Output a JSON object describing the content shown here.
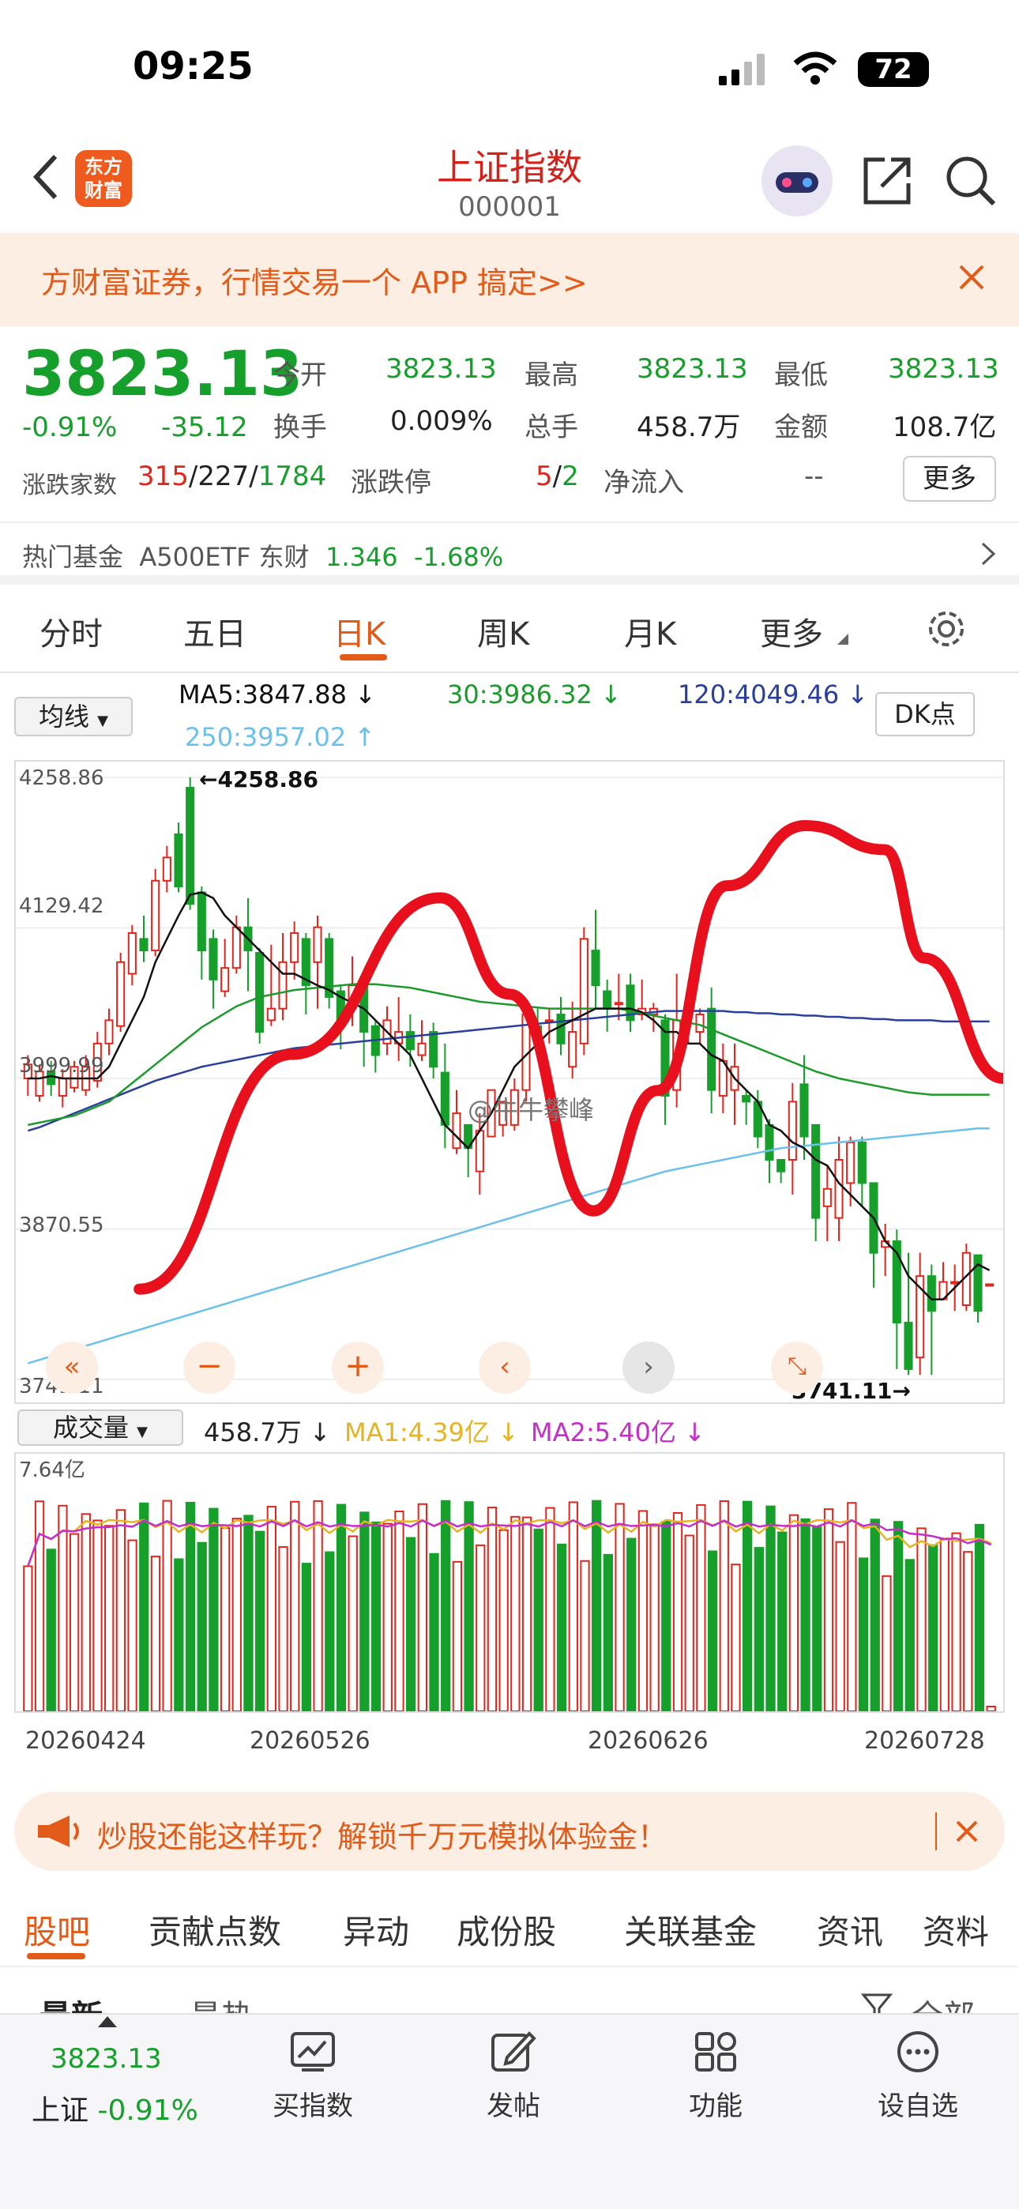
{
  "status_bar": {
    "time": "09:25",
    "battery": "72"
  },
  "header": {
    "title": "上证指数",
    "code": "000001",
    "logo_text": "东方财富"
  },
  "promo_banner": {
    "text": "方财富证券，行情交易一个 APP 搞定>>"
  },
  "quote": {
    "price": "3823.13",
    "change_pct": "-0.91%",
    "change": "-35.12",
    "open_label": "今开",
    "open": "3823.13",
    "high_label": "最高",
    "high": "3823.13",
    "low_label": "最低",
    "low": "3823.13",
    "turnover_label": "换手",
    "turnover": "0.009%",
    "volume_label": "总手",
    "volume": "458.7万",
    "amount_label": "金额",
    "amount": "108.7亿",
    "breadth_label": "涨跌家数",
    "up": "315",
    "flat": "227",
    "down": "1784",
    "sep": "/",
    "limit_label": "涨跌停",
    "limit_up": "5",
    "limit_down": "2",
    "netflow_label": "净流入",
    "netflow": "--",
    "more_label": "更多"
  },
  "hot_fund": {
    "label": "热门基金",
    "name": "A500ETF 东财",
    "price": "1.346",
    "change": "-1.68%"
  },
  "period_tabs": [
    "分时",
    "五日",
    "日K",
    "周K",
    "月K",
    "更多"
  ],
  "active_period": "日K",
  "ma": {
    "selector": "均线",
    "ma5": "MA5:3847.88 ↓",
    "ma30": "30:3986.32 ↓",
    "ma120": "120:4049.46 ↓",
    "ma250": "250:3957.02 ↑",
    "dk": "DK点"
  },
  "colors": {
    "up": "#e0251c",
    "down": "#16a02b",
    "ma5": "#111111",
    "ma30": "#1d9a2b",
    "ma120": "#2a3f9c",
    "ma250": "#6cc1ea",
    "accent": "#e25b18",
    "overlay": "#e8101c"
  },
  "chart_data": {
    "type": "candlestick",
    "ylim": [
      3741.11,
      4258.86
    ],
    "y_ticks": [
      "4258.86",
      "4129.42",
      "3999.99",
      "3870.55",
      "3741.11"
    ],
    "high_marker": "←4258.86",
    "low_marker": "3741.11→",
    "watermark": "@牛牛攀峰",
    "x_ticks": [
      "20260424",
      "20260526",
      "20260626",
      "20260728"
    ],
    "candles": [
      [
        4000,
        4012,
        4020,
        3985
      ],
      [
        3985,
        4006,
        4012,
        3980
      ],
      [
        4006,
        3995,
        4015,
        3985
      ],
      [
        3985,
        4000,
        4008,
        3975
      ],
      [
        3992,
        4010,
        4015,
        3988
      ],
      [
        3990,
        4010,
        4020,
        3985
      ],
      [
        3998,
        4030,
        4040,
        3992
      ],
      [
        4030,
        4050,
        4060,
        4020
      ],
      [
        4045,
        4100,
        4108,
        4040
      ],
      [
        4090,
        4125,
        4132,
        4080
      ],
      [
        4120,
        4110,
        4140,
        4100
      ],
      [
        4110,
        4170,
        4180,
        4105
      ],
      [
        4170,
        4190,
        4200,
        4160
      ],
      [
        4210,
        4165,
        4220,
        4160
      ],
      [
        4250,
        4150,
        4259,
        4145
      ],
      [
        4160,
        4110,
        4165,
        4085
      ],
      [
        4120,
        4085,
        4128,
        4060
      ],
      [
        4075,
        4095,
        4120,
        4070
      ],
      [
        4095,
        4130,
        4140,
        4090
      ],
      [
        4130,
        4110,
        4155,
        4075
      ],
      [
        4108,
        4040,
        4112,
        4030
      ],
      [
        4050,
        4060,
        4115,
        4045
      ],
      [
        4060,
        4100,
        4125,
        4050
      ],
      [
        4100,
        4125,
        4135,
        4085
      ],
      [
        4120,
        4080,
        4125,
        4055
      ],
      [
        4100,
        4130,
        4140,
        4060
      ],
      [
        4120,
        4070,
        4125,
        4060
      ],
      [
        4075,
        4045,
        4080,
        4025
      ],
      [
        4060,
        4080,
        4105,
        4045
      ],
      [
        4080,
        4040,
        4086,
        4010
      ],
      [
        4045,
        4020,
        4050,
        4005
      ],
      [
        4030,
        4050,
        4062,
        4020
      ],
      [
        4030,
        4040,
        4070,
        4015
      ],
      [
        4040,
        4025,
        4055,
        4010
      ],
      [
        4020,
        4030,
        4050,
        4015
      ],
      [
        4040,
        4010,
        4048,
        4000
      ],
      [
        4005,
        3960,
        4030,
        3940
      ],
      [
        3940,
        3970,
        3990,
        3935
      ],
      [
        3960,
        3940,
        3960,
        3915
      ],
      [
        3920,
        3955,
        3970,
        3900
      ],
      [
        3950,
        3990,
        3990,
        3960
      ],
      [
        3960,
        3980,
        3980,
        3950
      ],
      [
        3960,
        3990,
        4000,
        3955
      ],
      [
        3990,
        4055,
        4060,
        3980
      ],
      [
        4045,
        4030,
        4060,
        4020
      ],
      [
        4050,
        4050,
        4060,
        4030
      ],
      [
        4055,
        4030,
        4070,
        4020
      ],
      [
        4010,
        4040,
        4066,
        4000
      ],
      [
        4030,
        4120,
        4130,
        4020
      ],
      [
        4110,
        4080,
        4145,
        4060
      ],
      [
        4075,
        4060,
        4085,
        4040
      ],
      [
        4065,
        4065,
        4090,
        4050
      ],
      [
        4080,
        4050,
        4090,
        4040
      ],
      [
        4055,
        4060,
        4085,
        4050
      ],
      [
        4055,
        4060,
        4065,
        4040
      ],
      [
        4050,
        3985,
        4055,
        3960
      ],
      [
        3990,
        4050,
        4090,
        3975
      ],
      [
        4055,
        4060,
        4080,
        4030
      ],
      [
        4040,
        4055,
        4060,
        4030
      ],
      [
        4060,
        3990,
        4078,
        3970
      ],
      [
        3985,
        4015,
        4030,
        3970
      ],
      [
        3990,
        4010,
        4030,
        3960
      ],
      [
        3985,
        3980,
        3990,
        3960
      ],
      [
        3980,
        3950,
        3990,
        3940
      ],
      [
        3960,
        3930,
        3965,
        3910
      ],
      [
        3930,
        3920,
        3930,
        3910
      ],
      [
        3930,
        3980,
        3996,
        3900
      ],
      [
        3995,
        3950,
        4020,
        3930
      ],
      [
        3960,
        3880,
        3960,
        3860
      ],
      [
        3890,
        3905,
        3925,
        3860
      ],
      [
        3880,
        3930,
        3950,
        3860
      ],
      [
        3910,
        3945,
        3950,
        3890
      ],
      [
        3945,
        3910,
        3950,
        3890
      ],
      [
        3910,
        3850,
        3910,
        3820
      ],
      [
        3855,
        3860,
        3875,
        3830
      ],
      [
        3860,
        3790,
        3870,
        3750
      ],
      [
        3790,
        3750,
        3850,
        3745
      ],
      [
        3760,
        3830,
        3850,
        3745
      ],
      [
        3830,
        3800,
        3840,
        3745
      ],
      [
        3810,
        3825,
        3842,
        3810
      ],
      [
        3825,
        3825,
        3840,
        3800
      ],
      [
        3805,
        3850,
        3858,
        3800
      ],
      [
        3848,
        3800,
        3848,
        3790
      ],
      [
        3823,
        3823,
        3823,
        3823
      ]
    ],
    "ma5": [
      4000,
      4000,
      4002,
      4000,
      4000,
      4000,
      4000,
      4010,
      4030,
      4050,
      4070,
      4100,
      4120,
      4140,
      4158,
      4160,
      4155,
      4140,
      4130,
      4120,
      4110,
      4100,
      4090,
      4090,
      4085,
      4080,
      4076,
      4070,
      4065,
      4060,
      4050,
      4040,
      4030,
      4020,
      4000,
      3980,
      3960,
      3950,
      3940,
      3955,
      3970,
      3990,
      4010,
      4020,
      4030,
      4040,
      4045,
      4050,
      4055,
      4060,
      4060,
      4060,
      4060,
      4057,
      4050,
      4040,
      4040,
      4030,
      4030,
      4020,
      4015,
      4000,
      3990,
      3980,
      3960,
      3955,
      3945,
      3940,
      3930,
      3925,
      3910,
      3900,
      3890,
      3880,
      3860,
      3850,
      3830,
      3820,
      3810,
      3810,
      3820,
      3830,
      3840,
      3835
    ],
    "ma30": [
      3960,
      3962,
      3964,
      3966,
      3968,
      3972,
      3976,
      3980,
      3988,
      3996,
      4004,
      4012,
      4020,
      4028,
      4036,
      4044,
      4050,
      4056,
      4062,
      4066,
      4070,
      4072,
      4074,
      4076,
      4077,
      4078,
      4079,
      4080,
      4081,
      4081,
      4081,
      4080,
      4079,
      4078,
      4076,
      4074,
      4072,
      4070,
      4068,
      4066,
      4065,
      4064,
      4063,
      4062,
      4061,
      4060,
      4060,
      4060,
      4060,
      4060,
      4060,
      4060,
      4058,
      4056,
      4054,
      4052,
      4050,
      4048,
      4046,
      4042,
      4038,
      4034,
      4030,
      4026,
      4022,
      4018,
      4014,
      4010,
      4006,
      4003,
      4000,
      3998,
      3996,
      3994,
      3992,
      3990,
      3988,
      3987,
      3986,
      3986,
      3986,
      3986,
      3986,
      3986
    ],
    "ma120": [
      3955,
      3958,
      3962,
      3966,
      3970,
      3974,
      3978,
      3982,
      3986,
      3990,
      3994,
      3998,
      4001,
      4004,
      4007,
      4010,
      4012,
      4014,
      4016,
      4018,
      4020,
      4022,
      4024,
      4026,
      4027,
      4028,
      4029,
      4030,
      4031,
      4032,
      4033,
      4034,
      4035,
      4036,
      4037,
      4038,
      4039,
      4040,
      4041,
      4042,
      4043,
      4044,
      4045,
      4046,
      4047,
      4048,
      4049,
      4050,
      4051,
      4052,
      4053,
      4054,
      4055,
      4056,
      4057,
      4058,
      4058,
      4058,
      4058,
      4058,
      4058,
      4057,
      4057,
      4056,
      4056,
      4055,
      4055,
      4054,
      4054,
      4053,
      4053,
      4052,
      4052,
      4051,
      4051,
      4050,
      4050,
      4050,
      4050,
      4049,
      4049,
      4049,
      4049,
      4049
    ],
    "ma250": [
      3755,
      3758,
      3761,
      3764,
      3767,
      3770,
      3773,
      3776,
      3779,
      3782,
      3785,
      3788,
      3791,
      3794,
      3797,
      3800,
      3803,
      3806,
      3809,
      3812,
      3815,
      3818,
      3821,
      3824,
      3827,
      3830,
      3833,
      3836,
      3839,
      3842,
      3845,
      3848,
      3851,
      3854,
      3857,
      3860,
      3863,
      3866,
      3869,
      3872,
      3875,
      3878,
      3881,
      3884,
      3887,
      3890,
      3893,
      3896,
      3899,
      3902,
      3905,
      3908,
      3911,
      3914,
      3917,
      3920,
      3922,
      3924,
      3926,
      3928,
      3930,
      3932,
      3934,
      3936,
      3938,
      3940,
      3941,
      3942,
      3943,
      3944,
      3945,
      3946,
      3947,
      3948,
      3949,
      3950,
      3951,
      3952,
      3953,
      3954,
      3955,
      3956,
      3957,
      3957
    ],
    "overlay_path": [
      [
        0.125,
        0.85
      ],
      [
        0.28,
        0.46
      ],
      [
        0.43,
        0.2
      ],
      [
        0.5,
        0.36
      ],
      [
        0.585,
        0.72
      ],
      [
        0.65,
        0.52
      ],
      [
        0.72,
        0.18
      ],
      [
        0.8,
        0.08
      ],
      [
        0.88,
        0.12
      ],
      [
        0.92,
        0.3
      ],
      [
        1.0,
        0.5
      ]
    ]
  },
  "volume": {
    "selector": "成交量",
    "total": "458.7万 ↓",
    "ma1": "MA1:4.39亿 ↓",
    "ma2": "MA2:5.40亿 ↓",
    "max_label": "7.64亿"
  },
  "ad_bar": {
    "text": "炒股还能这样玩？解锁千万元模拟体验金！"
  },
  "bottom_tabs": [
    "股吧",
    "贡献点数",
    "异动",
    "成份股",
    "关联基金",
    "资讯",
    "资料"
  ],
  "sub_tabs": {
    "left1": "最新",
    "left2": "最热",
    "right": "全部"
  },
  "nav": {
    "index_price": "3823.13",
    "index_name": "上证",
    "index_change": "-0.91%",
    "items": [
      "买指数",
      "发帖",
      "功能",
      "设自选"
    ]
  }
}
